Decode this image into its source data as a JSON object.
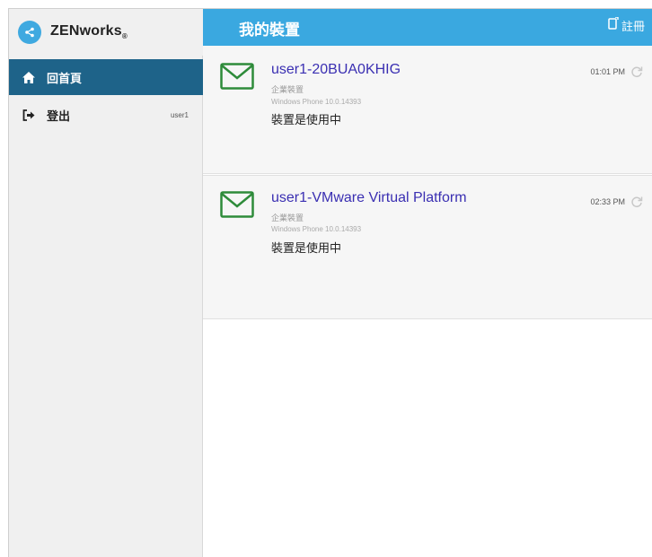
{
  "sidebar": {
    "brand": "ZENworks",
    "brand_mark": "®",
    "items": [
      {
        "label": "回首頁",
        "icon": "home-icon",
        "active": true
      },
      {
        "label": "登出",
        "icon": "logout-icon",
        "user": "user1"
      }
    ]
  },
  "header": {
    "title": "我的裝置",
    "register_label": "註冊",
    "register_icon": "enroll-icon"
  },
  "devices": [
    {
      "name": "user1-20BUA0KHIG",
      "type": "企業裝置",
      "os": "Windows Phone 10.0.14393",
      "status": "裝置是使用中",
      "time": "01:01 PM",
      "icon": "mail-icon"
    },
    {
      "name": "user1-VMware Virtual Platform",
      "type": "企業裝置",
      "os": "Windows Phone 10.0.14393",
      "status": "裝置是使用中",
      "time": "02:33 PM",
      "icon": "mail-icon"
    }
  ],
  "colors": {
    "header_bg": "#3aa8e0",
    "active_nav_bg": "#1e6389",
    "device_name": "#3a2fb2",
    "mail_icon": "#2e8b3a"
  }
}
